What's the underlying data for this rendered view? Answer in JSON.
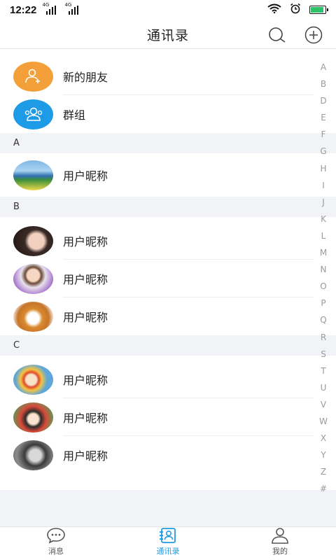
{
  "status": {
    "time": "12:22",
    "network1": "4G",
    "network2": "4G"
  },
  "header": {
    "title": "通讯录"
  },
  "top_items": [
    {
      "label": "新的朋友",
      "color": "#f4a03a",
      "icon": "add-user-icon"
    },
    {
      "label": "群组",
      "color": "#1e9be6",
      "icon": "group-icon"
    }
  ],
  "sections": [
    {
      "letter": "A",
      "contacts": [
        {
          "name": "用户昵称",
          "avatar": "landscape-avatar"
        }
      ]
    },
    {
      "letter": "B",
      "contacts": [
        {
          "name": "用户昵称",
          "avatar": "girl-portrait-avatar"
        },
        {
          "name": "用户昵称",
          "avatar": "child-avatar"
        },
        {
          "name": "用户昵称",
          "avatar": "dog-avatar"
        }
      ]
    },
    {
      "letter": "C",
      "contacts": [
        {
          "name": "用户昵称",
          "avatar": "cartoon-fish-avatar"
        },
        {
          "name": "用户昵称",
          "avatar": "cartoon-boy-avatar"
        },
        {
          "name": "用户昵称",
          "avatar": "woman-bw-avatar"
        }
      ]
    }
  ],
  "index_letters": [
    "A",
    "B",
    "D",
    "E",
    "F",
    "G",
    "H",
    "I",
    "J",
    "K",
    "L",
    "M",
    "N",
    "O",
    "P",
    "Q",
    "R",
    "S",
    "T",
    "U",
    "V",
    "W",
    "X",
    "Y",
    "Z",
    "#"
  ],
  "tabs": [
    {
      "label": "消息",
      "icon": "chat-icon",
      "active": false
    },
    {
      "label": "通讯录",
      "icon": "contacts-icon",
      "active": true
    },
    {
      "label": "我的",
      "icon": "profile-icon",
      "active": false
    }
  ],
  "colors": {
    "accent": "#1e9be6",
    "orange": "#f4a03a",
    "battery": "#2ec26a"
  }
}
